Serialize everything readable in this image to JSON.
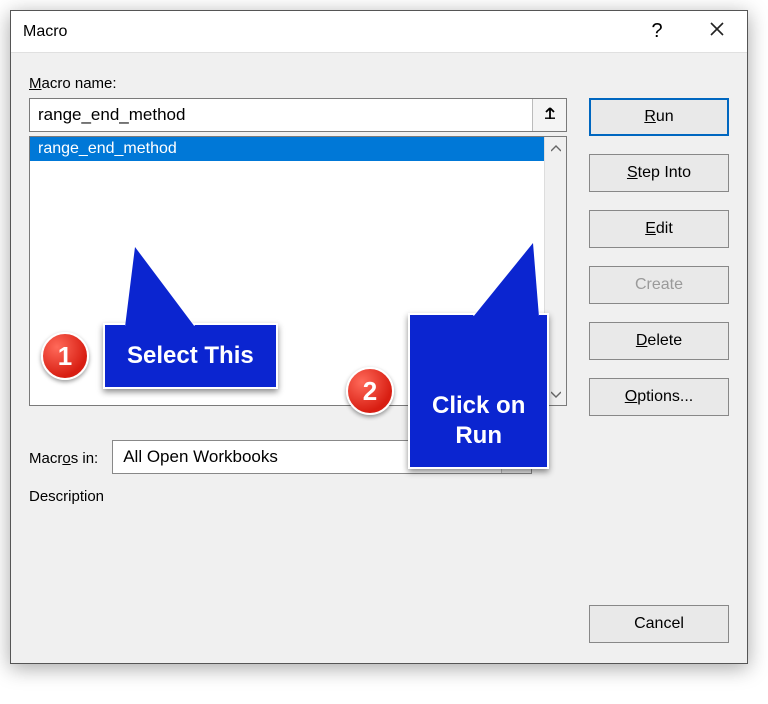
{
  "title": "Macro",
  "labels": {
    "macro_name_prefix": "M",
    "macro_name_rest": "acro name:",
    "macros_in": "Macr",
    "macros_in_u": "o",
    "macros_in_rest": "s in:",
    "description": "Description"
  },
  "macro_input": "range_end_method",
  "list": {
    "items": [
      "range_end_method"
    ],
    "selected_index": 0
  },
  "macros_in_value": "All Open Workbooks",
  "buttons": {
    "run_u": "R",
    "run_rest": "un",
    "step_u": "S",
    "step_rest": "tep Into",
    "edit_u": "E",
    "edit_rest": "dit",
    "create_u": "C",
    "create_rest": "reate",
    "delete_u": "D",
    "delete_rest": "elete",
    "options_u": "O",
    "options_rest": "ptions...",
    "cancel": "Cancel"
  },
  "callouts": {
    "c1_num": "1",
    "c1_text": "Select This",
    "c2_num": "2",
    "c2_text": "Click on Run"
  }
}
